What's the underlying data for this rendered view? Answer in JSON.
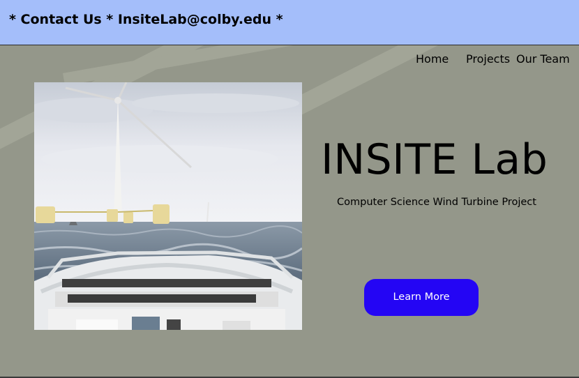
{
  "header": {
    "contact_text": "* Contact Us * InsiteLab@colby.edu *"
  },
  "nav": {
    "items": [
      {
        "label": "Home"
      },
      {
        "label": "Projects"
      },
      {
        "label": "Our Team"
      }
    ]
  },
  "hero": {
    "title": "INSITE Lab",
    "subtitle": "Computer Science Wind Turbine Project",
    "cta_label": "Learn More",
    "image": "wind-turbine-boat-scene"
  },
  "colors": {
    "header_bg": "#a4befa",
    "page_bg": "#94978a",
    "accent": "#2405f4"
  }
}
